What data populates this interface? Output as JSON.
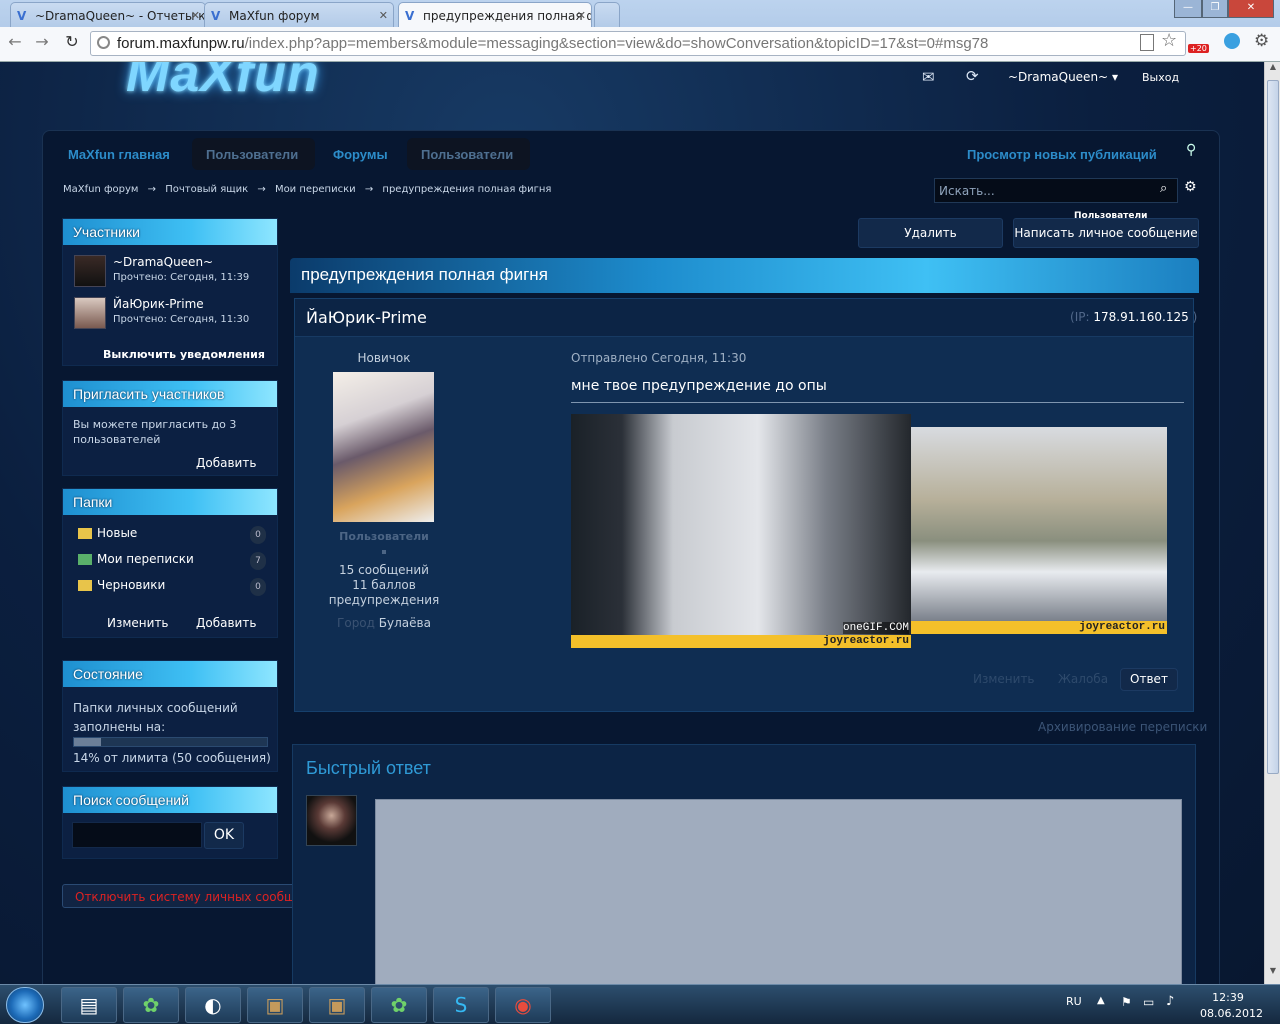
{
  "browser": {
    "tabs": [
      {
        "label": "~DramaQueen~ - Отчеты к"
      },
      {
        "label": "MaXfun форум"
      },
      {
        "label": "предупреждения полная ф"
      }
    ],
    "url_host": "forum.maxfunpw.ru",
    "url_rest": "/index.php?app=members&module=messaging&section=view&do=showConversation&topicID=17&st=0#msg78",
    "ext_badge": "+20"
  },
  "header": {
    "logo": "MaXfun",
    "username": "~DramaQueen~",
    "logout": "Выход",
    "members_label": "Пользователи"
  },
  "nav": {
    "items": [
      "MaXfun главная",
      "Пользователи",
      "Форумы",
      "Пользователи"
    ],
    "new_posts": "Просмотр новых публикаций"
  },
  "breadcrumb": [
    "MaXfun форум",
    "Почтовый ящик",
    "Мои переписки",
    "предупреждения полная фигня"
  ],
  "search": {
    "placeholder": "Искать..."
  },
  "sidebar": {
    "participants": {
      "title": "Участники",
      "users": [
        {
          "name": "~DramaQueen~",
          "read": "Прочтено: Сегодня, 11:39"
        },
        {
          "name": "ЙаЮрик-Prime",
          "read": "Прочтено: Сегодня, 11:30"
        }
      ],
      "disable_notifications": "Выключить уведомления"
    },
    "invite": {
      "title": "Пригласить участников",
      "text": "Вы можете пригласить до 3 пользователей",
      "add": "Добавить"
    },
    "folders": {
      "title": "Папки",
      "items": [
        {
          "label": "Новые",
          "count": "0"
        },
        {
          "label": "Мои переписки",
          "count": "7"
        },
        {
          "label": "Черновики",
          "count": "0"
        }
      ],
      "edit": "Изменить",
      "add": "Добавить"
    },
    "status": {
      "title": "Состояние",
      "text": "Папки личных сообщений заполнены на:",
      "usage": "14% от лимита (50 сообщения)",
      "fill": 0.14
    },
    "search_messages": {
      "title": "Поиск сообщений",
      "ok": "OK"
    },
    "disable_pm": "Отключить систему личных сообщений"
  },
  "actions": {
    "delete": "Удалить",
    "compose": "Написать личное сообщение"
  },
  "topic": {
    "title": "предупреждения полная фигня"
  },
  "post": {
    "author": "ЙаЮрик-Prime",
    "ip_label": "IP:",
    "ip": "178.91.160.125",
    "rank": "Новичок",
    "group": "Пользователи",
    "posts": "15 сообщений",
    "points": "11 баллов",
    "warnings": "предупреждения",
    "city_label": "Город",
    "city": "Булаёва",
    "sent": "Отправлено Сегодня, 11:30",
    "text": "мне твое предупреждение до опы",
    "gif1_watermark": "oneGIF.COM",
    "gif1_caption": "joyreactor.ru",
    "gif2_caption": "joyreactor.ru",
    "edit": "Изменить",
    "report": "Жалоба",
    "reply": "Ответ"
  },
  "archive": "Архивирование переписки",
  "quick_reply": {
    "title": "Быстрый ответ"
  },
  "taskbar": {
    "lang": "RU",
    "time": "12:39",
    "date": "08.06.2012"
  }
}
